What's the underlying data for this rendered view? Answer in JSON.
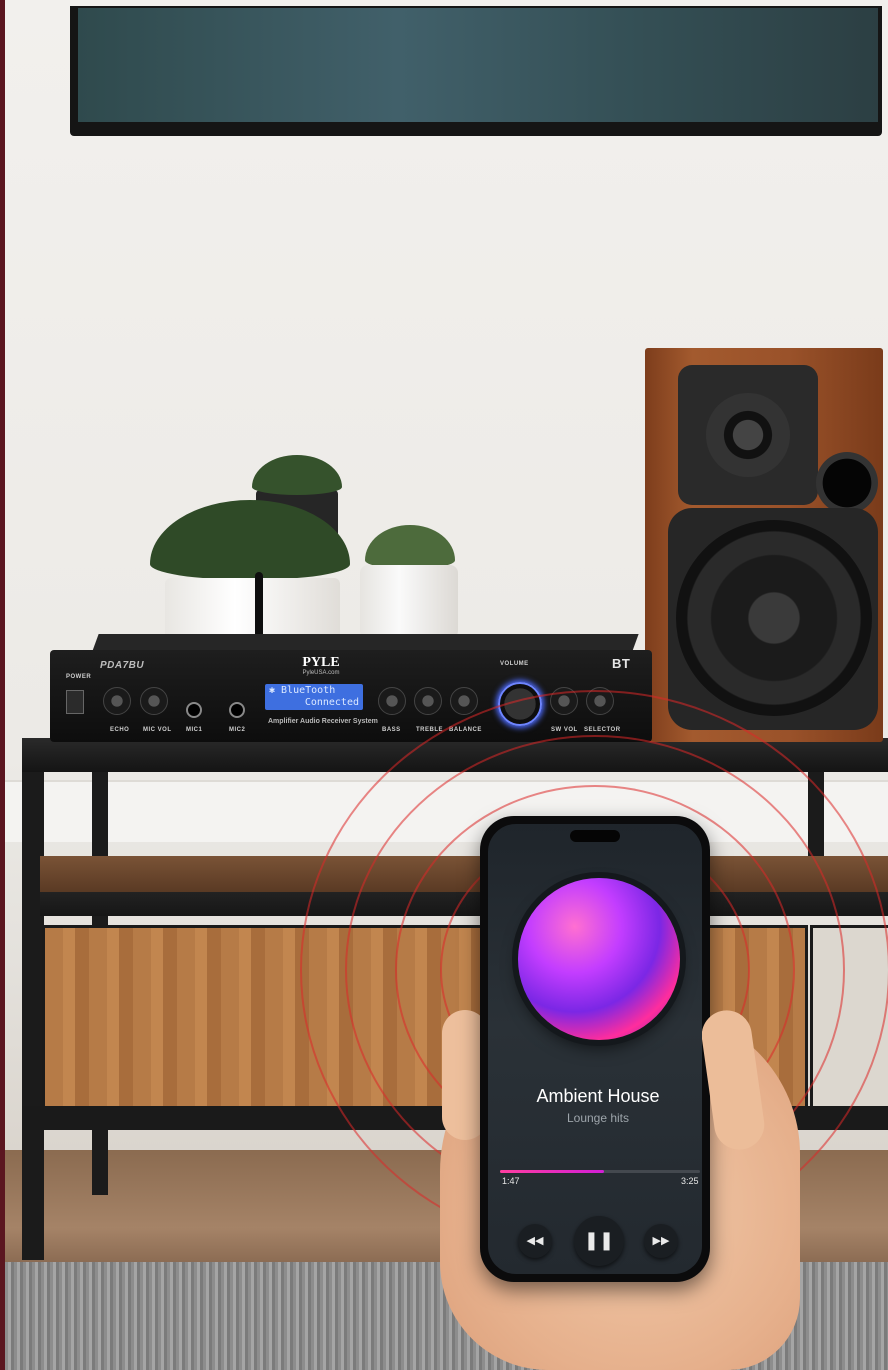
{
  "amplifier": {
    "model": "PDA7BU",
    "brand": "PYLE",
    "brand_site": "PyleUSA.com",
    "bluetooth_badge": "BT",
    "display_line1": "✱ BlueTooth",
    "display_line2": "Connected",
    "subtitle": "Amplifier Audio Receiver System",
    "labels": {
      "power": "POWER",
      "echo": "ECHO",
      "mic_vol": "MIC VOL",
      "mic1": "MIC1",
      "mic2": "MIC2",
      "bass": "BASS",
      "treble": "TREBLE",
      "balance": "BALANCE",
      "volume": "VOLUME",
      "sw_vol": "SW VOL",
      "selector": "SELECTOR"
    }
  },
  "player": {
    "title": "Ambient House",
    "subtitle": "Lounge hits",
    "time_current": "1:47",
    "time_total": "3:25",
    "progress": 0.52,
    "prev_icon": "rewind-icon",
    "play_icon": "pause-icon",
    "next_icon": "fast-forward-icon"
  },
  "colors": {
    "wave": "#dc2828",
    "lcd": "#3e6fe0",
    "accent": "#ff3ea0"
  }
}
